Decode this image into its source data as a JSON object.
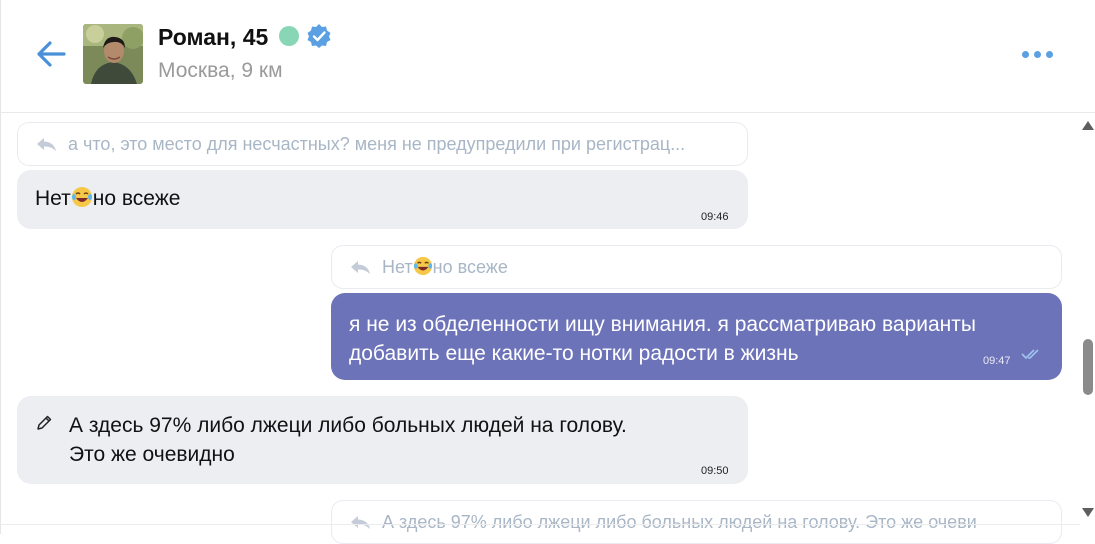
{
  "header": {
    "name": "Роман, 45",
    "location": "Москва, 9 км",
    "online_color": "#88d6b6",
    "verified_color": "#5aa0e3"
  },
  "messages": [
    {
      "reply_to": "а что, это место для несчастных? меня не предупредили при регистрац...",
      "text_before": "Нет",
      "emoji": "laughing-tears",
      "text_after": "но всеже",
      "time": "09:46",
      "direction": "incoming"
    },
    {
      "reply_before": "Нет",
      "reply_emoji": "laughing-tears",
      "reply_after": "но всеже",
      "text": "я не из обделенности ищу внимания. я рассматриваю варианты добавить еще какие-то нотки радости в жизнь",
      "time": "09:47",
      "direction": "outgoing",
      "status": "read"
    },
    {
      "text": "А здесь 97% либо лжеци либо больных людей на голову. Это же очевидно",
      "time": "09:50",
      "direction": "incoming",
      "edited": true
    },
    {
      "reply_to": "А здесь 97% либо лжеци либо больных людей на голову. Это же очеви",
      "direction": "outgoing"
    }
  ],
  "colors": {
    "outgoing_bubble": "#6d73b9",
    "incoming_bubble": "#eceef2",
    "accent": "#5aa0e3"
  }
}
